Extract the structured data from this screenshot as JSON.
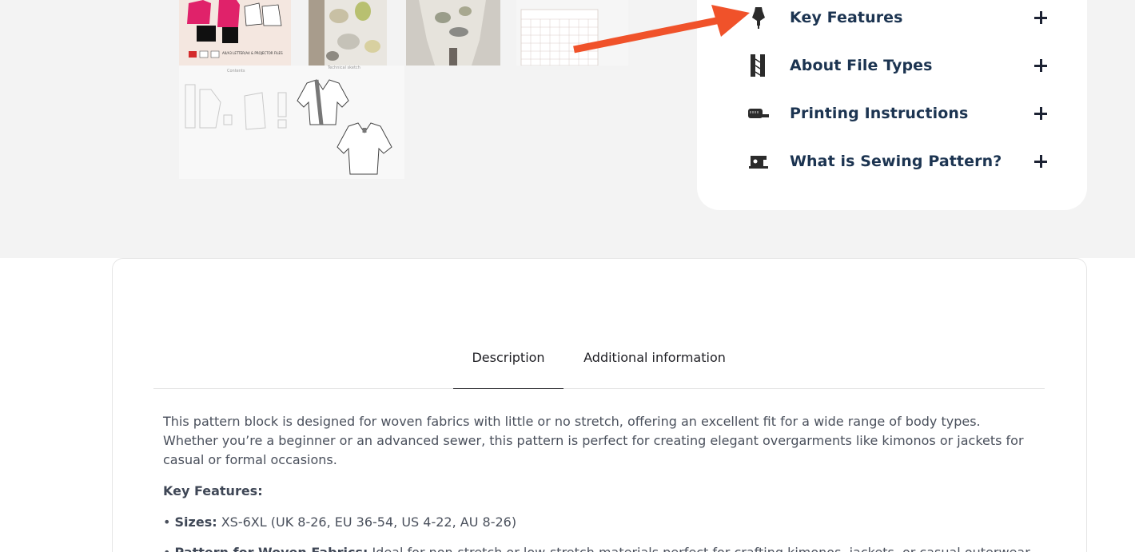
{
  "accordion": {
    "items": [
      {
        "label": "Key Features",
        "icon": "dress-form-icon"
      },
      {
        "label": "About File Types",
        "icon": "file-types-icon"
      },
      {
        "label": "Printing Instructions",
        "icon": "measuring-tape-icon"
      },
      {
        "label": "What is Sewing Pattern?",
        "icon": "sewing-machine-icon"
      }
    ],
    "label_color": "#1c3451"
  },
  "gallery": {
    "thumb1_caption": "A0/A3 LETTER/A4 & PROJECTOR FILES",
    "thumb5_caption_left": "Contents",
    "thumb5_caption_right": "Technical sketch"
  },
  "tabs": {
    "description": "Description",
    "additional": "Additional information"
  },
  "description": {
    "intro": " This pattern block is designed for woven fabrics with little or no stretch, offering an excellent fit for a wide range of body types. Whether you’re a beginner or an advanced sewer, this pattern is perfect for creating elegant overgarments like kimonos or jackets for casual or formal occasions.",
    "key_features_heading": "Key Features:",
    "bullets": [
      {
        "label": "Sizes:",
        "text": " XS-6XL (UK 8-26, EU 36-54, US 4-22, AU 8-26)"
      },
      {
        "label": "Pattern for Woven Fabrics:",
        "text": " Ideal for non-stretch or low-stretch materials perfect for crafting kimonos, jackets, or casual outerwear"
      }
    ]
  },
  "colors": {
    "arrow": "#f0522a",
    "background": "#f3f3f3"
  }
}
